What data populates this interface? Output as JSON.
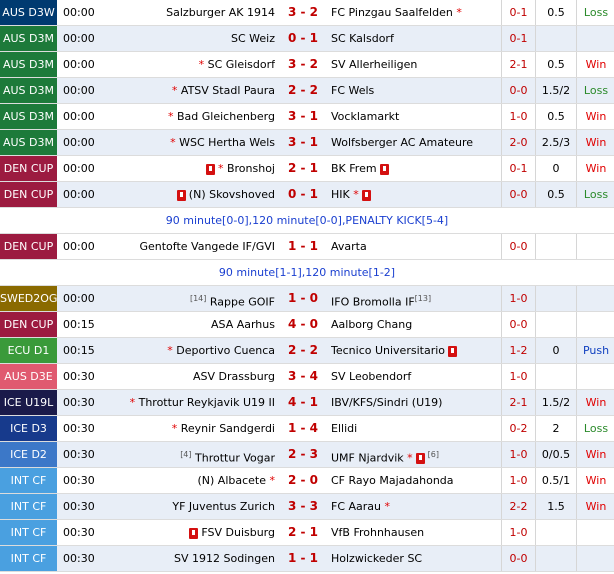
{
  "colors": {
    "AUS D3W": "#003a70",
    "AUS D3M": "#1d7a3a",
    "AUS D3E": "#e05a70",
    "DEN CUP": "#9c1b40",
    "SWED2OG": "#8a6a00",
    "ECU D1": "#3a9a3a",
    "ICE U19L": "#1a1a4a",
    "ICE D3": "#173a8c",
    "ICE D2": "#3c78c8",
    "INT CF": "#4aa0e0"
  },
  "rows": [
    {
      "type": "match",
      "league": "AUS D3W",
      "time": "00:00",
      "home": "Salzburger AK 1914",
      "score": "3 - 2",
      "away": "FC Pinzgau Saalfelden",
      "away_star": "*",
      "hc": "0-1",
      "ou": "0.5",
      "res": "Loss",
      "res_class": "loss"
    },
    {
      "type": "match",
      "league": "AUS D3M",
      "time": "00:00",
      "home": "SC Weiz",
      "score": "0 - 1",
      "away": "SC Kalsdorf",
      "hc": "0-1",
      "ou": "",
      "res": "",
      "res_class": ""
    },
    {
      "type": "match",
      "league": "AUS D3M",
      "time": "00:00",
      "home_star": "*",
      "home": "SC Gleisdorf",
      "score": "3 - 2",
      "away": "SV Allerheiligen",
      "hc": "2-1",
      "ou": "0.5",
      "res": "Win",
      "res_class": "win"
    },
    {
      "type": "match",
      "league": "AUS D3M",
      "time": "00:00",
      "home_star": "*",
      "home": "ATSV Stadl Paura",
      "score": "2 - 2",
      "away": "FC Wels",
      "hc": "0-0",
      "ou": "1.5/2",
      "res": "Loss",
      "res_class": "loss"
    },
    {
      "type": "match",
      "league": "AUS D3M",
      "time": "00:00",
      "home_star": "*",
      "home": "Bad Gleichenberg",
      "score": "3 - 1",
      "away": "Vocklamarkt",
      "hc": "1-0",
      "ou": "0.5",
      "res": "Win",
      "res_class": "win"
    },
    {
      "type": "match",
      "league": "AUS D3M",
      "time": "00:00",
      "home_star": "*",
      "home": "WSC Hertha Wels",
      "score": "3 - 1",
      "away": "Wolfsberger AC Amateure",
      "hc": "2-0",
      "ou": "2.5/3",
      "res": "Win",
      "res_class": "win"
    },
    {
      "type": "match",
      "league": "DEN CUP",
      "time": "00:00",
      "home_card": true,
      "home_star": "*",
      "home": "Bronshoj",
      "score": "2 - 1",
      "away": "BK Frem",
      "away_card": true,
      "hc": "0-1",
      "ou": "0",
      "res": "Win",
      "res_class": "win"
    },
    {
      "type": "match",
      "league": "DEN CUP",
      "time": "00:00",
      "home_card": true,
      "home": "(N) Skovshoved",
      "score": "0 - 1",
      "away": "HIK",
      "away_star": "*",
      "away_card": true,
      "hc": "0-0",
      "ou": "0.5",
      "res": "Loss",
      "res_class": "loss"
    },
    {
      "type": "info",
      "text": "90 minute[0-0],120 minute[0-0],PENALTY KICK[5-4]"
    },
    {
      "type": "match",
      "league": "DEN CUP",
      "time": "00:00",
      "home": "Gentofte Vangede IF/GVI",
      "score": "1 - 1",
      "away": "Avarta",
      "hc": "0-0",
      "ou": "",
      "res": "",
      "res_class": ""
    },
    {
      "type": "info",
      "text": "90 minute[1-1],120 minute[1-2]"
    },
    {
      "type": "match",
      "league": "SWED2OG",
      "time": "00:00",
      "home_sup": "[14]",
      "home": "Rappe GOIF",
      "score": "1 - 0",
      "away": "IFO Bromolla IF",
      "away_sup": "[13]",
      "hc": "1-0",
      "ou": "",
      "res": "",
      "res_class": ""
    },
    {
      "type": "match",
      "league": "DEN CUP",
      "time": "00:15",
      "home": "ASA Aarhus",
      "score": "4 - 0",
      "away": "Aalborg Chang",
      "hc": "0-0",
      "ou": "",
      "res": "",
      "res_class": ""
    },
    {
      "type": "match",
      "league": "ECU D1",
      "time": "00:15",
      "home_star": "*",
      "home": "Deportivo Cuenca",
      "score": "2 - 2",
      "away": "Tecnico Universitario",
      "away_card": true,
      "hc": "1-2",
      "ou": "0",
      "res": "Push",
      "res_class": "push"
    },
    {
      "type": "match",
      "league": "AUS D3E",
      "time": "00:30",
      "home": "ASV Drassburg",
      "score": "3 - 4",
      "away": "SV Leobendorf",
      "hc": "1-0",
      "ou": "",
      "res": "",
      "res_class": ""
    },
    {
      "type": "match",
      "league": "ICE U19L",
      "time": "00:30",
      "home_star": "*",
      "home": "Throttur Reykjavik U19 II",
      "score": "4 - 1",
      "away": "IBV/KFS/Sindri (U19)",
      "hc": "2-1",
      "ou": "1.5/2",
      "res": "Win",
      "res_class": "win"
    },
    {
      "type": "match",
      "league": "ICE D3",
      "time": "00:30",
      "home_star": "*",
      "home": "Reynir Sandgerdi",
      "score": "1 - 4",
      "away": "Ellidi",
      "hc": "0-2",
      "ou": "2",
      "res": "Loss",
      "res_class": "loss"
    },
    {
      "type": "match",
      "league": "ICE D2",
      "time": "00:30",
      "home_sup": "[4]",
      "home": "Throttur Vogar",
      "score": "2 - 3",
      "away": "UMF Njardvik",
      "away_star": "*",
      "away_card": true,
      "away_sup": "[6]",
      "hc": "1-0",
      "ou": "0/0.5",
      "res": "Win",
      "res_class": "win"
    },
    {
      "type": "match",
      "league": "INT CF",
      "time": "00:30",
      "home": "(N) Albacete",
      "home_star_after": "*",
      "score": "2 - 0",
      "away": "CF Rayo Majadahonda",
      "hc": "1-0",
      "ou": "0.5/1",
      "res": "Win",
      "res_class": "win"
    },
    {
      "type": "match",
      "league": "INT CF",
      "time": "00:30",
      "home": "YF Juventus Zurich",
      "score": "3 - 3",
      "away": "FC Aarau",
      "away_star": "*",
      "hc": "2-2",
      "ou": "1.5",
      "res": "Win",
      "res_class": "win"
    },
    {
      "type": "match",
      "league": "INT CF",
      "time": "00:30",
      "home_card": true,
      "home": "FSV Duisburg",
      "score": "2 - 1",
      "away": "VfB Frohnhausen",
      "hc": "1-0",
      "ou": "",
      "res": "",
      "res_class": ""
    },
    {
      "type": "match",
      "league": "INT CF",
      "time": "00:30",
      "home": "SV 1912 Sodingen",
      "score": "1 - 1",
      "away": "Holzwickeder SC",
      "hc": "0-0",
      "ou": "",
      "res": "",
      "res_class": ""
    }
  ]
}
